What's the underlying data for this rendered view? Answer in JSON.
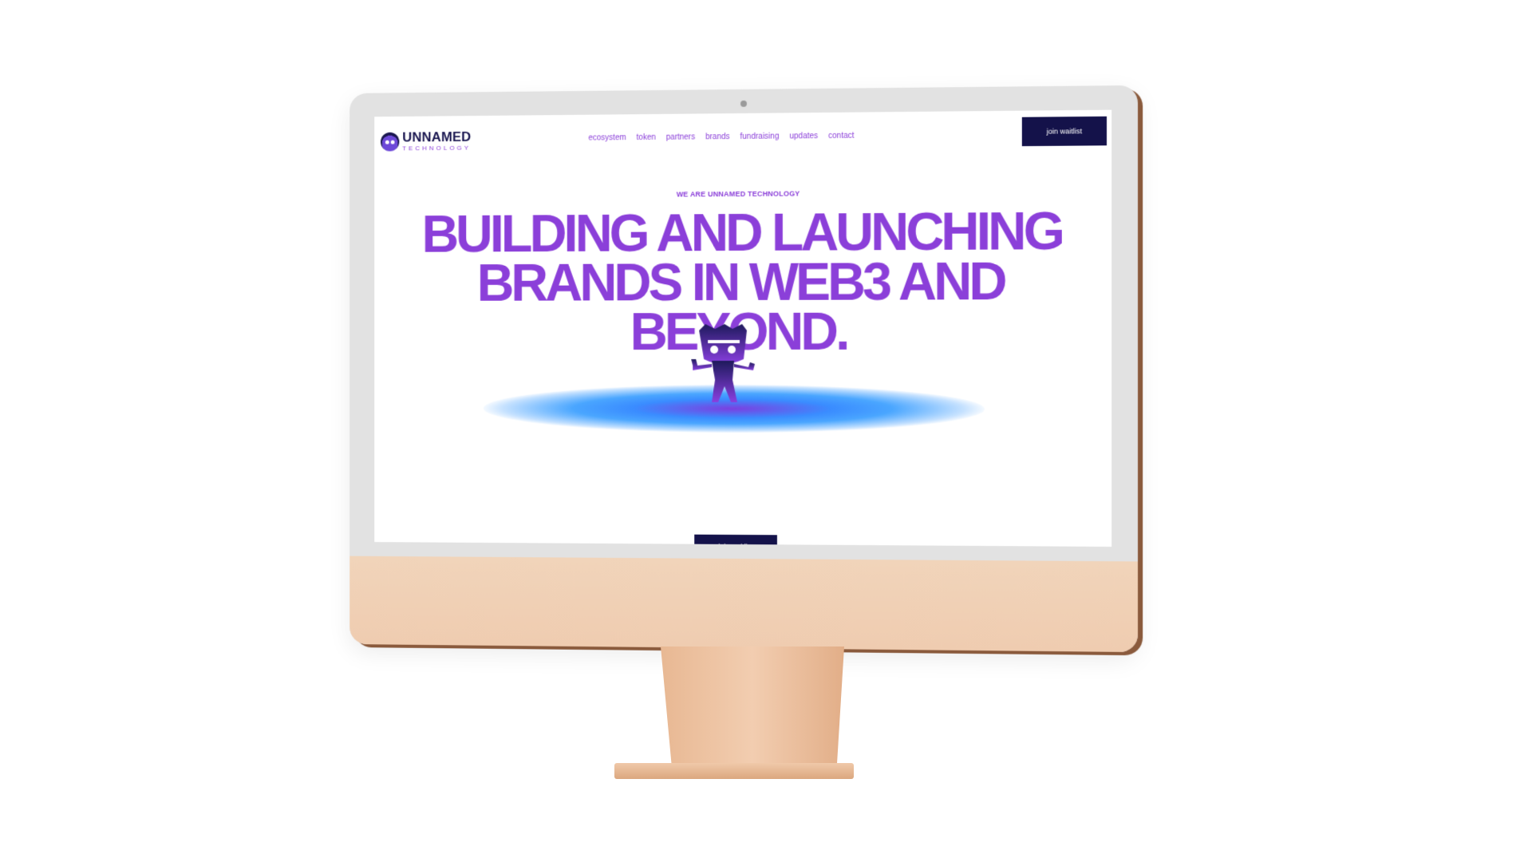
{
  "brand": {
    "name": "UNNAMED",
    "subtitle": "TECHNOLOGY"
  },
  "nav": {
    "items": [
      {
        "label": "ecosystem"
      },
      {
        "label": "token"
      },
      {
        "label": "partners"
      },
      {
        "label": "brands"
      },
      {
        "label": "fundraising"
      },
      {
        "label": "updates"
      },
      {
        "label": "contact"
      }
    ]
  },
  "header": {
    "cta_label": "join waitlist"
  },
  "hero": {
    "eyebrow": "WE ARE UNNAMED TECHNOLOGY",
    "headline": "BUILDING AND LAUNCHING\nBRANDS IN WEB3 AND\nBEYOND.",
    "cta_label": "join waitlist",
    "mascot_icon": "robot-mascot-icon"
  },
  "colors": {
    "accent": "#8b3fd9",
    "navy": "#14124a",
    "glow_blue": "#3a8cff",
    "monitor_chin": "#efccb0"
  }
}
